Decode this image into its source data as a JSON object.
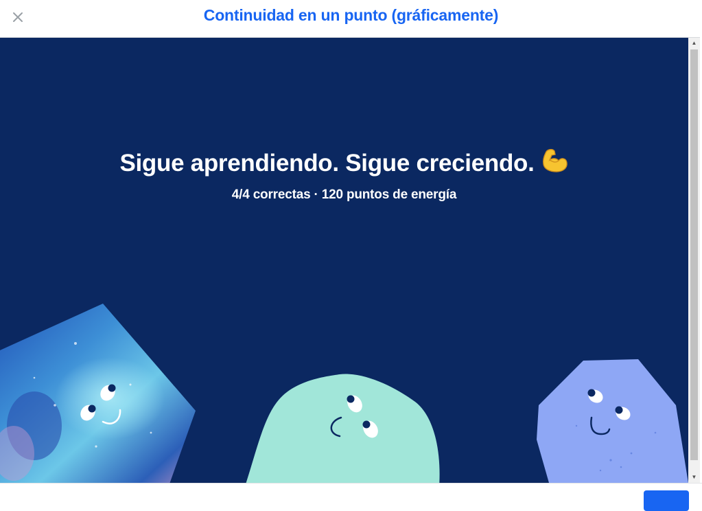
{
  "header": {
    "title": "Continuidad en un punto (gráficamente)",
    "close_icon": "close-icon"
  },
  "main": {
    "headline": "Sigue aprendiendo. Sigue creciendo.",
    "headline_icon": "flexed-biceps-icon",
    "correct": "4/4 correctas",
    "separator": "·",
    "energy": "120 puntos de energía"
  },
  "colors": {
    "accent": "#1865f2",
    "background": "#0b2861",
    "mint": "#a1e6d9",
    "lavender": "#8ea7f5"
  }
}
